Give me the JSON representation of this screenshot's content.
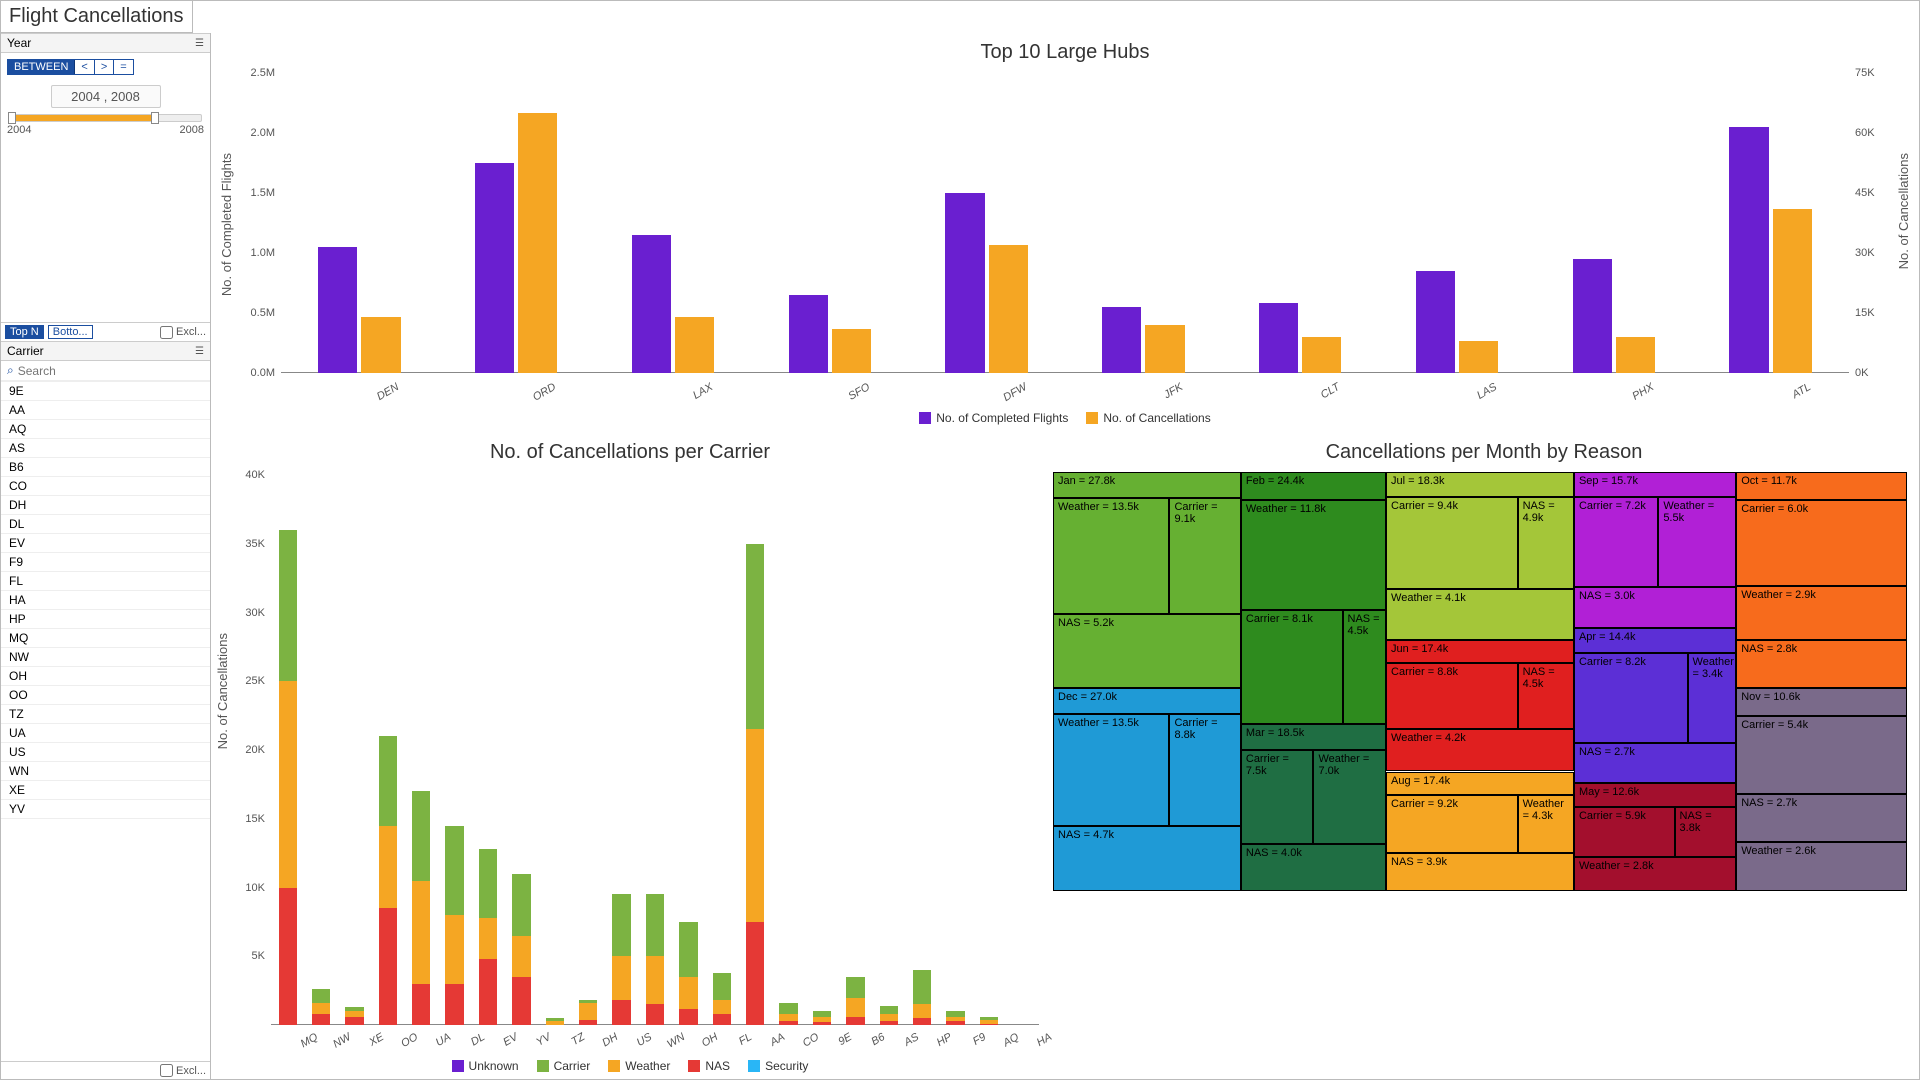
{
  "title": "Flight Cancellations",
  "year_filter": {
    "label": "Year",
    "mode": "BETWEEN",
    "ops": [
      "<",
      ">",
      "="
    ],
    "range_text": "2004 , 2008",
    "min": "2004",
    "max": "2008"
  },
  "topn": {
    "top": "Top N",
    "bottom": "Botto...",
    "excl": "Excl..."
  },
  "carrier_panel": {
    "label": "Carrier",
    "search_placeholder": "Search",
    "items": [
      "9E",
      "AA",
      "AQ",
      "AS",
      "B6",
      "CO",
      "DH",
      "DL",
      "EV",
      "F9",
      "FL",
      "HA",
      "HP",
      "MQ",
      "NW",
      "OH",
      "OO",
      "TZ",
      "UA",
      "US",
      "WN",
      "XE",
      "YV"
    ],
    "excl": "Excl..."
  },
  "chart_top": {
    "title": "Top 10 Large Hubs",
    "legend": [
      "No. of Completed Flights",
      "No. of Cancellations"
    ],
    "yleft_label": "No. of Completed Flights",
    "yright_label": "No. of Cancellations",
    "yleft_ticks": [
      "0.0M",
      "0.5M",
      "1.0M",
      "1.5M",
      "2.0M",
      "2.5M"
    ],
    "yright_ticks": [
      "0K",
      "15K",
      "30K",
      "45K",
      "60K",
      "75K"
    ]
  },
  "chart_bl": {
    "title": "No. of Cancellations per Carrier",
    "ylab": "No. of Cancellations",
    "yticks": [
      "5K",
      "10K",
      "15K",
      "20K",
      "25K",
      "30K",
      "35K",
      "40K"
    ],
    "legend": [
      "Unknown",
      "Carrier",
      "Weather",
      "NAS",
      "Security"
    ]
  },
  "treemap": {
    "title": "Cancellations per Month by Reason"
  },
  "chart_data": [
    {
      "type": "bar",
      "title": "Top 10 Large Hubs",
      "categories": [
        "DEN",
        "ORD",
        "LAX",
        "SFO",
        "DFW",
        "JFK",
        "CLT",
        "LAS",
        "PHX",
        "ATL"
      ],
      "series": [
        {
          "name": "No. of Completed Flights",
          "axis": "left",
          "values": [
            1.05,
            1.75,
            1.15,
            0.65,
            1.5,
            0.55,
            0.58,
            0.85,
            0.95,
            2.05
          ],
          "unit": "M"
        },
        {
          "name": "No. of Cancellations",
          "axis": "right",
          "values": [
            14,
            65,
            14,
            11,
            32,
            12,
            9,
            8,
            9,
            41
          ],
          "unit": "K"
        }
      ],
      "ylim_left": [
        0,
        2.5
      ],
      "ylim_right": [
        0,
        75
      ],
      "colors": {
        "No. of Completed Flights": "#6a1fd0",
        "No. of Cancellations": "#f5a623"
      }
    },
    {
      "type": "bar-stacked",
      "title": "No. of Cancellations per Carrier",
      "categories": [
        "MQ",
        "NW",
        "XE",
        "OO",
        "UA",
        "DL",
        "EV",
        "YV",
        "TZ",
        "DH",
        "US",
        "WN",
        "OH",
        "FL",
        "AA",
        "CO",
        "9E",
        "B6",
        "AS",
        "HP",
        "F9",
        "AQ",
        "HA"
      ],
      "stack_order": [
        "NAS",
        "Weather",
        "Carrier",
        "Unknown"
      ],
      "series": {
        "NAS": [
          10,
          0.8,
          0.6,
          8.5,
          3,
          3,
          4.8,
          3.5,
          0,
          0.4,
          1.8,
          1.5,
          1.2,
          0.8,
          7.5,
          0.3,
          0.2,
          0.6,
          0.3,
          0.5,
          0.3,
          0.1,
          0
        ],
        "Weather": [
          15,
          0.8,
          0.4,
          6,
          7.5,
          5,
          3,
          3,
          0.3,
          1.2,
          3.2,
          3.5,
          2.3,
          1,
          14,
          0.5,
          0.4,
          1.4,
          0.5,
          1,
          0.3,
          0.3,
          0
        ],
        "Carrier": [
          11,
          1,
          0.3,
          6.5,
          6.5,
          6.5,
          5,
          4.5,
          0.2,
          0.2,
          4.5,
          4.5,
          4,
          2,
          13.5,
          0.8,
          0.4,
          1.5,
          0.6,
          2.5,
          0.4,
          0.2,
          0
        ],
        "Unknown": [
          0,
          0,
          0,
          0,
          0,
          0,
          0,
          0,
          0,
          0,
          0,
          0,
          0,
          0,
          0,
          0,
          0,
          0,
          0,
          0,
          0,
          0,
          0
        ]
      },
      "ylim": [
        0,
        40
      ],
      "unit": "K",
      "colors": {
        "Unknown": "#6a1fd0",
        "Carrier": "#7cb342",
        "Weather": "#f5a623",
        "NAS": "#e53935",
        "Security": "#29b6f6"
      }
    },
    {
      "type": "treemap",
      "title": "Cancellations per Month by Reason",
      "nodes": [
        {
          "month": "Jan",
          "total": 27.8,
          "color": "#66b032",
          "children": [
            {
              "reason": "Weather",
              "v": 13.5
            },
            {
              "reason": "Carrier",
              "v": 9.1
            },
            {
              "reason": "NAS",
              "v": 5.2
            }
          ]
        },
        {
          "month": "Feb",
          "total": 24.4,
          "color": "#2e8b1e",
          "children": [
            {
              "reason": "Weather",
              "v": 11.8
            },
            {
              "reason": "Carrier",
              "v": 8.1
            },
            {
              "reason": "NAS",
              "v": 4.5
            }
          ]
        },
        {
          "month": "Mar",
          "total": 18.5,
          "color": "#1f6e43",
          "children": [
            {
              "reason": "Carrier",
              "v": 7.5
            },
            {
              "reason": "Weather",
              "v": 7.0
            },
            {
              "reason": "NAS",
              "v": 4.0
            }
          ]
        },
        {
          "month": "Apr",
          "total": 14.4,
          "color": "#5c2fd6",
          "children": [
            {
              "reason": "Carrier",
              "v": 8.2
            },
            {
              "reason": "Weather",
              "v": 3.4
            },
            {
              "reason": "NAS",
              "v": 2.7
            }
          ]
        },
        {
          "month": "May",
          "total": 12.6,
          "color": "#a30f2d",
          "children": [
            {
              "reason": "Carrier",
              "v": 5.9
            },
            {
              "reason": "NAS",
              "v": 3.8
            },
            {
              "reason": "Weather",
              "v": 2.8
            }
          ]
        },
        {
          "month": "Jun",
          "total": 17.4,
          "color": "#e01f1f",
          "children": [
            {
              "reason": "Carrier",
              "v": 8.8
            },
            {
              "reason": "NAS",
              "v": 4.5
            },
            {
              "reason": "Weather",
              "v": 4.2
            }
          ]
        },
        {
          "month": "Jul",
          "total": 18.3,
          "color": "#a4c639",
          "children": [
            {
              "reason": "Carrier",
              "v": 9.4
            },
            {
              "reason": "NAS",
              "v": 4.9
            },
            {
              "reason": "Weather",
              "v": 4.1
            }
          ]
        },
        {
          "month": "Aug",
          "total": 17.4,
          "color": "#f5a623",
          "children": [
            {
              "reason": "Carrier",
              "v": 9.2
            },
            {
              "reason": "Weather",
              "v": 4.3
            },
            {
              "reason": "NAS",
              "v": 3.9
            }
          ]
        },
        {
          "month": "Sep",
          "total": 15.7,
          "color": "#b120d6",
          "children": [
            {
              "reason": "Carrier",
              "v": 7.2
            },
            {
              "reason": "Weather",
              "v": 5.5
            },
            {
              "reason": "NAS",
              "v": 3.0
            }
          ]
        },
        {
          "month": "Oct",
          "total": 11.7,
          "color": "#f76b1c",
          "children": [
            {
              "reason": "Carrier",
              "v": 6.0
            },
            {
              "reason": "Weather",
              "v": 2.9
            },
            {
              "reason": "NAS",
              "v": 2.8
            }
          ]
        },
        {
          "month": "Nov",
          "total": 10.6,
          "color": "#7a6a8a",
          "children": [
            {
              "reason": "Carrier",
              "v": 5.4
            },
            {
              "reason": "NAS",
              "v": 2.7
            },
            {
              "reason": "Weather",
              "v": 2.6
            }
          ]
        },
        {
          "month": "Dec",
          "total": 27.0,
          "color": "#1f9ad6",
          "children": [
            {
              "reason": "Weather",
              "v": 13.5
            },
            {
              "reason": "Carrier",
              "v": 8.8
            },
            {
              "reason": "NAS",
              "v": 4.7
            }
          ]
        }
      ],
      "unit": "k"
    }
  ]
}
